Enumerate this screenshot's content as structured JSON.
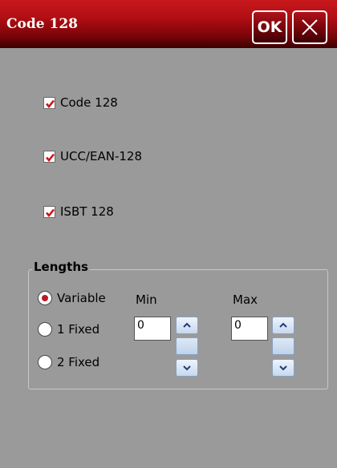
{
  "window": {
    "title": "Code 128",
    "ok_label": "OK",
    "close_icon": "close-icon"
  },
  "symbologies": [
    {
      "label": "Code 128",
      "checked": true
    },
    {
      "label": "UCC/EAN-128",
      "checked": true
    },
    {
      "label": "ISBT 128",
      "checked": true
    }
  ],
  "lengths": {
    "title": "Lengths",
    "options": [
      {
        "label": "Variable",
        "selected": true
      },
      {
        "label": "1 Fixed",
        "selected": false
      },
      {
        "label": "2 Fixed",
        "selected": false
      }
    ],
    "min_label": "Min",
    "max_label": "Max",
    "min_value": "0",
    "max_value": "0"
  },
  "colors": {
    "titlebar": "#b30f14",
    "background": "#9a9a9a",
    "check": "#d0131a"
  }
}
